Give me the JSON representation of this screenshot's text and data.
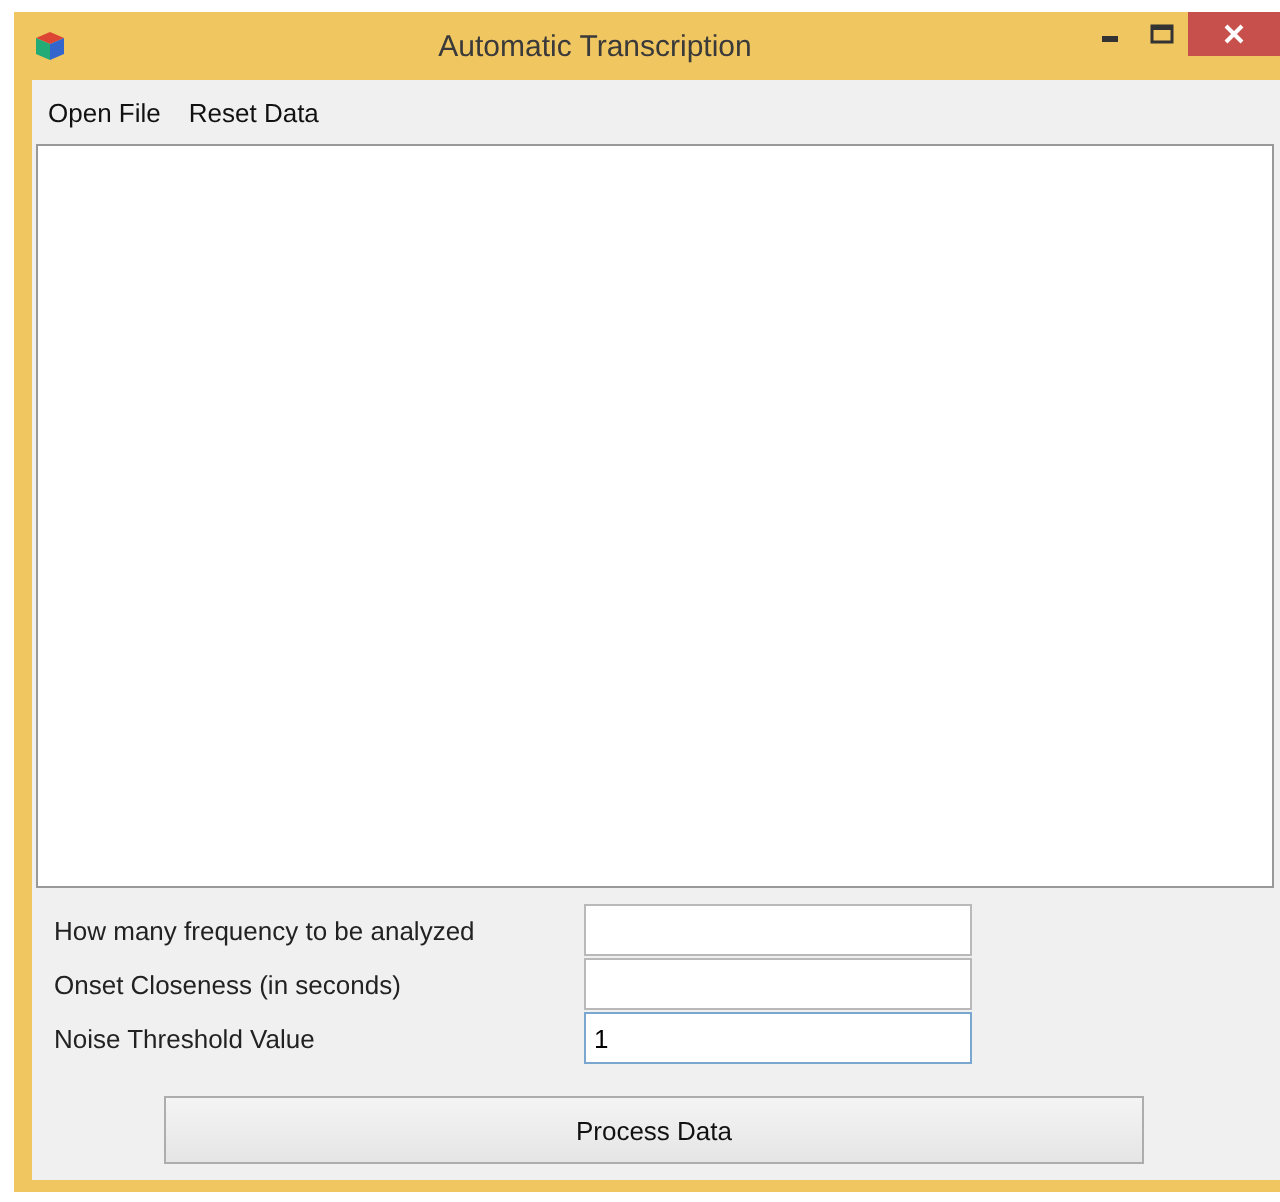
{
  "window": {
    "title": "Automatic Transcription"
  },
  "menu": [
    "Open File",
    "Reset Data"
  ],
  "fields": [
    {
      "label": "How many frequency to be analyzed",
      "focused": false
    },
    {
      "label": "Onset Closeness (in seconds)",
      "focused": false
    },
    {
      "label": "Noise Threshold Value",
      "value": "1",
      "focused": true
    }
  ],
  "button": "Process Data"
}
